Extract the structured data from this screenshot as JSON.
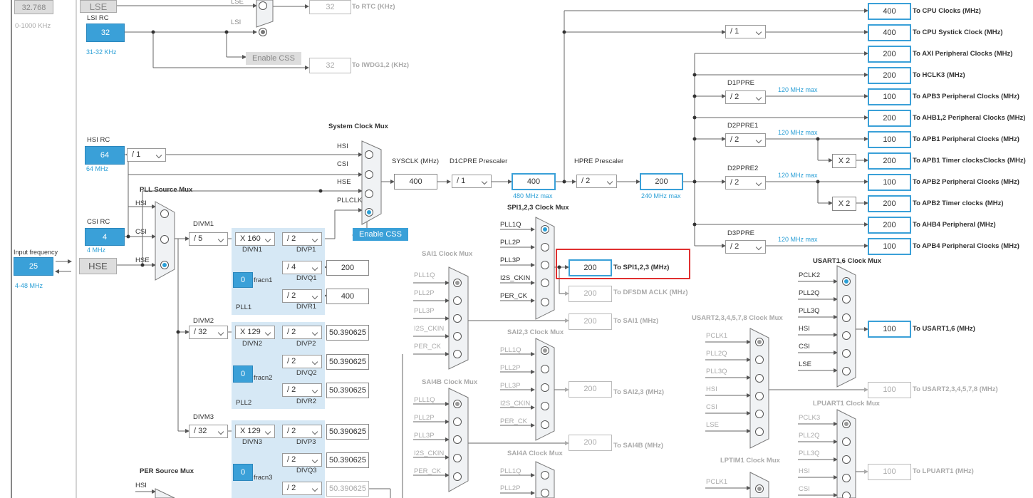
{
  "sources": {
    "freq_lse_left": "32.768",
    "range_lse": "0-1000 KHz",
    "lse": "LSE",
    "lsi_rc_label": "LSI RC",
    "lsi_value": "32",
    "lsi_range": "31-32 KHz",
    "hsi_rc_label": "HSI RC",
    "hsi_value": "64",
    "hsi_range": "64 MHz",
    "csi_rc_label": "CSI RC",
    "csi_value": "4",
    "csi_range": "4 MHz",
    "input_freq_label": "Input frequency",
    "hse_input": "25",
    "hse_range": "4-48 MHz",
    "hse": "HSE"
  },
  "rtc": {
    "lse_mux_label": "LSE",
    "lsi_mux_label": "LSI",
    "enable_css": "Enable CSS",
    "rtc_value": "32",
    "rtc_dest": "To RTC (KHz)",
    "iwdg_value": "32",
    "iwdg_dest": "To IWDG1,2 (KHz)"
  },
  "sysmux": {
    "title": "System Clock Mux",
    "hsi": "HSI",
    "csi": "CSI",
    "hse": "HSE",
    "pllclk": "PLLCLK",
    "enable_css": "Enable CSS",
    "hsi_div": "/ 1"
  },
  "pll_mux": {
    "title": "PLL Source Mux",
    "hsi": "HSI",
    "csi": "CSI",
    "hse": "HSE"
  },
  "pll1": {
    "divm_label": "DIVM1",
    "divm": "/ 5",
    "divn": "X 160",
    "divn_label": "DIVN1",
    "divp": "/ 2",
    "divp_label": "DIVP1",
    "divq": "/ 4",
    "divq_label": "DIVQ1",
    "q_out": "200",
    "divr": "/ 2",
    "divr_label": "DIVR1",
    "r_out": "400",
    "frac": "0",
    "frac_label": "fracn1",
    "name": "PLL1"
  },
  "pll2": {
    "divm_label": "DIVM2",
    "divm": "/ 32",
    "divn": "X 129",
    "divn_label": "DIVN2",
    "divp": "/ 2",
    "divp_label": "DIVP2",
    "p_out": "50.390625",
    "divq": "/ 2",
    "divq_label": "DIVQ2",
    "q_out": "50.390625",
    "divr": "/ 2",
    "divr_label": "DIVR2",
    "r_out": "50.390625",
    "frac": "0",
    "frac_label": "fracn2",
    "name": "PLL2"
  },
  "pll3": {
    "divm_label": "DIVM3",
    "divm": "/ 32",
    "divn": "X 129",
    "divn_label": "DIVN3",
    "divp": "/ 2",
    "divp_label": "DIVP3",
    "p_out": "50.390625",
    "divq": "/ 2",
    "divq_label": "DIVQ3",
    "q_out": "50.390625",
    "divr": "/ 2",
    "r_out": "50.390625",
    "frac": "0",
    "frac_label": "fracn3"
  },
  "core": {
    "sysclk_label": "SYSCLK (MHz)",
    "sysclk": "400",
    "d1cpre_label": "D1CPRE Prescaler",
    "d1cpre": "/ 1",
    "d1_out": "400",
    "d1_max": "480 MHz max",
    "hpre_label": "HPRE Prescaler",
    "hpre": "/ 2",
    "hpre_out": "200",
    "hpre_max": "240 MHz max"
  },
  "outputs": {
    "cpu": "400",
    "cpu_dest": "To CPU Clocks (MHz)",
    "systick_div": "/ 1",
    "systick": "400",
    "systick_dest": "To CPU Systick Clock (MHz)",
    "axi": "200",
    "axi_dest": "To AXI Peripheral Clocks (MHz)",
    "hclk3": "200",
    "hclk3_dest": "To HCLK3 (MHz)",
    "d1ppre_label": "D1PPRE",
    "d1ppre": "/ 2",
    "max1": "120 MHz max",
    "apb3": "100",
    "apb3_dest": "To APB3 Peripheral Clocks (MHz)",
    "ahb12": "200",
    "ahb12_dest": "To AHB1,2 Peripheral Clocks (MHz)",
    "d2ppre1_label": "D2PPRE1",
    "d2ppre1": "/ 2",
    "max2": "120 MHz max",
    "apb1": "100",
    "apb1_dest": "To APB1 Peripheral Clocks (MHz)",
    "x2a": "X 2",
    "apb1t": "200",
    "apb1t_dest": "To APB1 Timer clocksClocks (MHz)",
    "d2ppre2_label": "D2PPRE2",
    "d2ppre2": "/ 2",
    "max3": "120 MHz max",
    "apb2": "100",
    "apb2_dest": "To APB2 Peripheral Clocks (MHz)",
    "x2b": "X 2",
    "apb2t": "200",
    "apb2t_dest": "To APB2 Timer clocks (MHz)",
    "ahb4": "200",
    "ahb4_dest": "To AHB4 Peripheral (MHz)",
    "d3ppre_label": "D3PPRE",
    "d3ppre": "/ 2",
    "max4": "120 MHz max",
    "apb4": "100",
    "apb4_dest": "To APB4 Peripheral Clocks (MHz)"
  },
  "spi": {
    "title": "SPI1,2,3 Clock Mux",
    "in1": "PLL1Q",
    "in2": "PLL2P",
    "in3": "PLL3P",
    "in4": "I2S_CKIN",
    "in5": "PER_CK",
    "value": "200",
    "dest": "To SPI1,2,3 (MHz)",
    "dfsdm_value": "200",
    "dfsdm_dest": "To DFSDM ACLK (MHz)"
  },
  "sai1": {
    "title": "SAI1 Clock Mux",
    "in1": "PLL1Q",
    "in2": "PLL2P",
    "in3": "PLL3P",
    "in4": "I2S_CKIN",
    "in5": "PER_CK",
    "value": "200",
    "dest": "To SAI1 (MHz)"
  },
  "sai23": {
    "title": "SAI2,3 Clock Mux",
    "in1": "PLL1Q",
    "in2": "PLL2P",
    "in3": "PLL3P",
    "in4": "I2S_CKIN",
    "in5": "PER_CK",
    "value": "200",
    "dest": "To SAI2,3 (MHz)"
  },
  "sai4b": {
    "title": "SAI4B Clock Mux",
    "in1": "PLL1Q",
    "in2": "PLL2P",
    "in3": "PLL3P",
    "in4": "I2S_CKIN",
    "in5": "PER_CK",
    "value": "200",
    "dest": "To SAI4B (MHz)"
  },
  "sai4a": {
    "title": "SAI4A Clock Mux",
    "in1": "PLL1Q",
    "in2": "PLL2P"
  },
  "usart16": {
    "title": "USART1,6 Clock Mux",
    "in1": "PCLK2",
    "in2": "PLL2Q",
    "in3": "PLL3Q",
    "in4": "HSI",
    "in5": "CSI",
    "in6": "LSE",
    "value": "100",
    "dest": "To USART1,6 (MHz)"
  },
  "usart2": {
    "title": "USART2,3,4,5,7,8 Clock Mux",
    "in1": "PCLK1",
    "in2": "PLL2Q",
    "in3": "PLL3Q",
    "in4": "HSI",
    "in5": "CSI",
    "in6": "LSE",
    "value": "100",
    "dest": "To USART2,3,4,5,7,8 (MHz)"
  },
  "lpuart": {
    "title": "LPUART1 Clock Mux",
    "in1": "PCLK3",
    "in2": "PLL2Q",
    "in3": "PLL3Q",
    "in4": "HSI",
    "in5": "CSI",
    "value": "100",
    "dest": "To LPUART1 (MHz)"
  },
  "lptim": {
    "title": "LPTIM1 Clock Mux",
    "in1": "PCLK1"
  },
  "per_mux": {
    "title": "PER Source Mux",
    "hsi": "HSI"
  }
}
